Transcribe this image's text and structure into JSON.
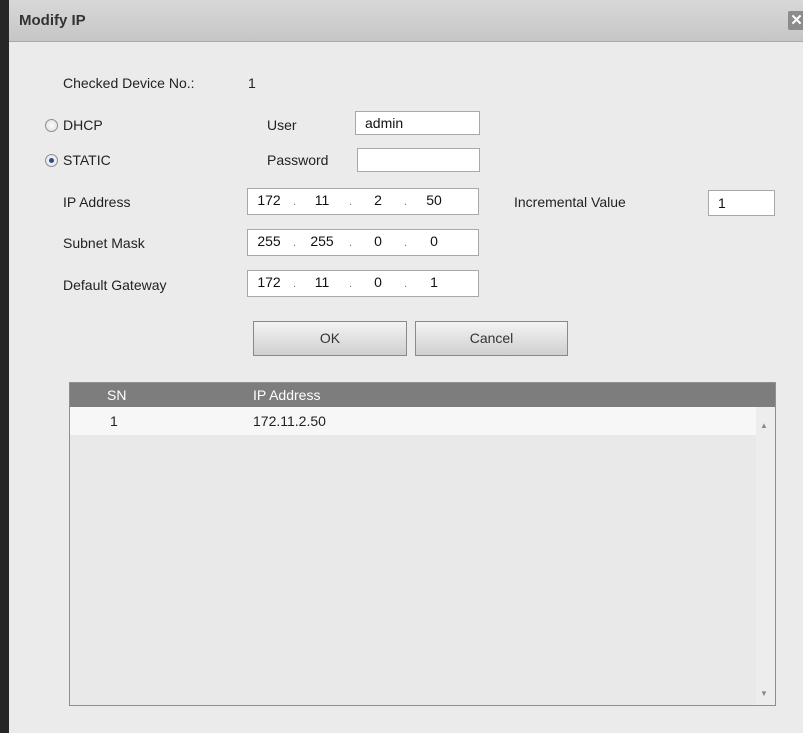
{
  "dialog": {
    "title": "Modify IP",
    "close_glyph": "✕"
  },
  "checked_device": {
    "label": "Checked Device No.:",
    "value": "1"
  },
  "mode": {
    "dhcp_label": "DHCP",
    "static_label": "STATIC",
    "selected": "STATIC"
  },
  "credentials": {
    "user_label": "User",
    "user_value": "admin",
    "password_label": "Password",
    "password_value": ""
  },
  "network": {
    "ip_label": "IP Address",
    "ip": [
      "172",
      "11",
      "2",
      "50"
    ],
    "mask_label": "Subnet Mask",
    "mask": [
      "255",
      "255",
      "0",
      "0"
    ],
    "gateway_label": "Default Gateway",
    "gateway": [
      "172",
      "11",
      "0",
      "1"
    ],
    "separator": "."
  },
  "incremental": {
    "label": "Incremental Value",
    "value": "1"
  },
  "buttons": {
    "ok": "OK",
    "cancel": "Cancel"
  },
  "table": {
    "columns": [
      "SN",
      "IP Address"
    ],
    "rows": [
      {
        "sn": "1",
        "ip": "172.11.2.50"
      }
    ],
    "scroll_up": "▲",
    "scroll_down": "▼"
  },
  "colors": {
    "titlebar": "#c9c9c9",
    "table_header": "#7d7d7d",
    "radio_selected": "#2b4e86",
    "background": "#ebebeb"
  },
  "icons": {
    "close": "close-icon",
    "scroll_up": "scroll-up-icon",
    "scroll_down": "scroll-down-icon"
  }
}
